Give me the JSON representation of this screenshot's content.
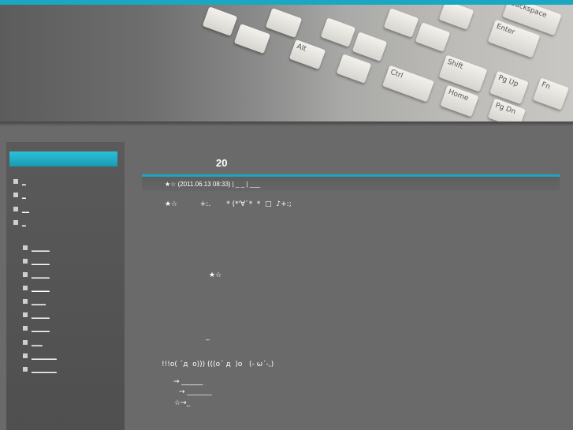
{
  "header": {
    "keys": [
      "Backspace",
      "Enter",
      "Shift",
      "Pg Up",
      "Fn",
      "Ctrl",
      "Home",
      "Pg Dn",
      "Alt"
    ]
  },
  "sidebar": {
    "title": "",
    "top_items": [
      "_",
      "_",
      "__",
      "_"
    ],
    "sub_items": [
      "_____",
      "_____",
      "_____",
      "_____",
      "____",
      "_____",
      "_____",
      "___",
      "_______",
      "_______"
    ]
  },
  "post": {
    "title": "20",
    "meta": "★☆ (2011.06.13 08:33) | _ _ | ___",
    "line1": "★☆          +:.       * (*'∀`*  *  □  ♪+:;",
    "line2": "★☆",
    "line3": "_",
    "line4": "!!!o( ´д  o))) (((o´ д  )o   (- ω´-,)",
    "line5": "→ ______",
    "line6": "→ _______",
    "line7": "☆→_"
  }
}
